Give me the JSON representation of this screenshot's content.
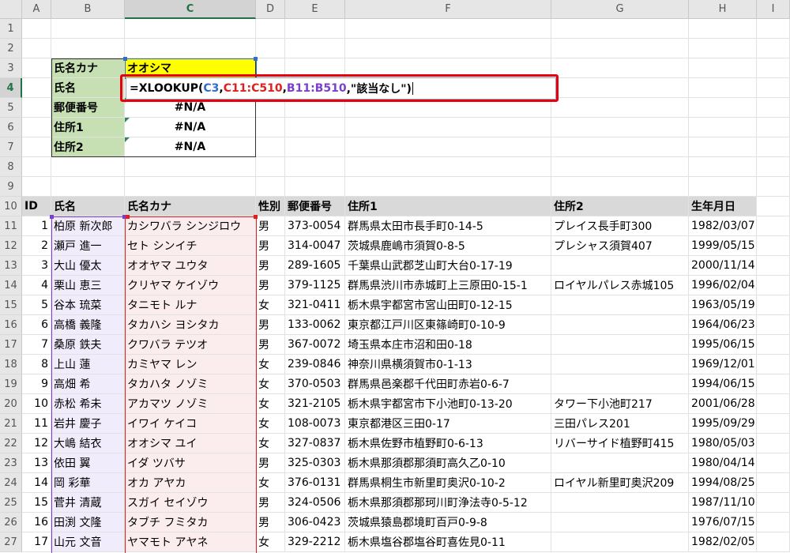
{
  "columns": [
    "A",
    "B",
    "C",
    "D",
    "E",
    "F",
    "G",
    "H",
    "I"
  ],
  "rows": [
    "1",
    "2",
    "3",
    "4",
    "5",
    "6",
    "7",
    "8",
    "9",
    "10",
    "11",
    "12",
    "13",
    "14",
    "15",
    "16",
    "17",
    "18",
    "19",
    "20",
    "21",
    "22",
    "23",
    "24",
    "25",
    "26",
    "27"
  ],
  "lookup": {
    "kana_label": "氏名カナ",
    "kana_value": "オオシマ",
    "name_label": "氏名",
    "zip_label": "郵便番号",
    "zip_value": "#N/A",
    "addr1_label": "住所1",
    "addr1_value": "#N/A",
    "addr2_label": "住所2",
    "addr2_value": "#N/A"
  },
  "formula": {
    "prefix": "=XLOOKUP(",
    "arg1": "C3",
    "sep1": ",",
    "arg2": "C11:C510",
    "sep2": ",",
    "arg3": "B11:B510",
    "suffix": ",\"該当なし\")"
  },
  "table": {
    "headers": [
      "ID",
      "氏名",
      "氏名カナ",
      "性別",
      "郵便番号",
      "住所1",
      "住所2",
      "生年月日"
    ],
    "rows": [
      [
        "1",
        "柏原 新次郎",
        "カシワバラ シンジロウ",
        "男",
        "373-0054",
        "群馬県太田市長手町0-14-5",
        "プレイス長手町300",
        "1982/03/07"
      ],
      [
        "2",
        "瀬戸 進一",
        "セト シンイチ",
        "男",
        "314-0047",
        "茨城県鹿嶋市須賀0-8-5",
        "プレシャス須賀407",
        "1999/05/15"
      ],
      [
        "3",
        "大山 優太",
        "オオヤマ ユウタ",
        "男",
        "289-1605",
        "千葉県山武郡芝山町大台0-17-19",
        "",
        "2000/11/14"
      ],
      [
        "4",
        "栗山 恵三",
        "クリヤマ ケイゾウ",
        "男",
        "379-1125",
        "群馬県渋川市赤城町上三原田0-15-1",
        "ロイヤルパレス赤城105",
        "1996/02/04"
      ],
      [
        "5",
        "谷本 琉菜",
        "タニモト ルナ",
        "女",
        "321-0411",
        "栃木県宇都宮市宮山田町0-12-15",
        "",
        "1963/05/19"
      ],
      [
        "6",
        "高橋 義隆",
        "タカハシ ヨシタカ",
        "男",
        "133-0062",
        "東京都江戸川区東篠崎町0-10-9",
        "",
        "1964/06/23"
      ],
      [
        "7",
        "桑原 鉄夫",
        "クワバラ テツオ",
        "男",
        "367-0072",
        "埼玉県本庄市沼和田0-18",
        "",
        "1995/06/15"
      ],
      [
        "8",
        "上山 蓮",
        "カミヤマ レン",
        "女",
        "239-0846",
        "神奈川県横須賀市0-1-13",
        "",
        "1969/12/01"
      ],
      [
        "9",
        "高畑 希",
        "タカハタ ノゾミ",
        "女",
        "370-0503",
        "群馬県邑楽郡千代田町赤岩0-6-7",
        "",
        "1994/06/15"
      ],
      [
        "10",
        "赤松 希未",
        "アカマツ ノゾミ",
        "女",
        "321-2105",
        "栃木県宇都宮市下小池町0-13-20",
        "タワー下小池町217",
        "2001/06/28"
      ],
      [
        "11",
        "岩井 慶子",
        "イワイ ケイコ",
        "女",
        "108-0073",
        "東京都港区三田0-17",
        "三田パレス201",
        "1995/09/29"
      ],
      [
        "12",
        "大嶋 結衣",
        "オオシマ ユイ",
        "女",
        "327-0837",
        "栃木県佐野市植野町0-6-13",
        "リバーサイド植野町415",
        "1980/05/03"
      ],
      [
        "13",
        "依田 翼",
        "イダ ツバサ",
        "男",
        "325-0303",
        "栃木県那須郡那須町高久乙0-10",
        "",
        "1980/04/14"
      ],
      [
        "14",
        "岡 彩華",
        "オカ アヤカ",
        "女",
        "376-0131",
        "群馬県桐生市新里町奥沢0-10-2",
        "ロイヤル新里町奥沢209",
        "1994/08/25"
      ],
      [
        "15",
        "菅井 清蔵",
        "スガイ セイゾウ",
        "男",
        "324-0506",
        "栃木県那須郡那珂川町浄法寺0-5-12",
        "",
        "1987/11/10"
      ],
      [
        "16",
        "田渕 文隆",
        "タブチ フミタカ",
        "男",
        "306-0423",
        "茨城県猿島郡境町百戸0-9-8",
        "",
        "1976/07/15"
      ],
      [
        "17",
        "山元 文音",
        "ヤマモト アヤネ",
        "女",
        "329-2212",
        "栃木県塩谷郡塩谷町喜佐見0-11",
        "",
        "1982/02/05"
      ]
    ]
  },
  "colors": {
    "label_fill": "#c6e0b4",
    "highlight": "#ffff00",
    "ref_c3": "#2f6dd0",
    "ref_c_range": "#e02020",
    "ref_b_range": "#7a3fcf",
    "callout": "#e60012"
  }
}
